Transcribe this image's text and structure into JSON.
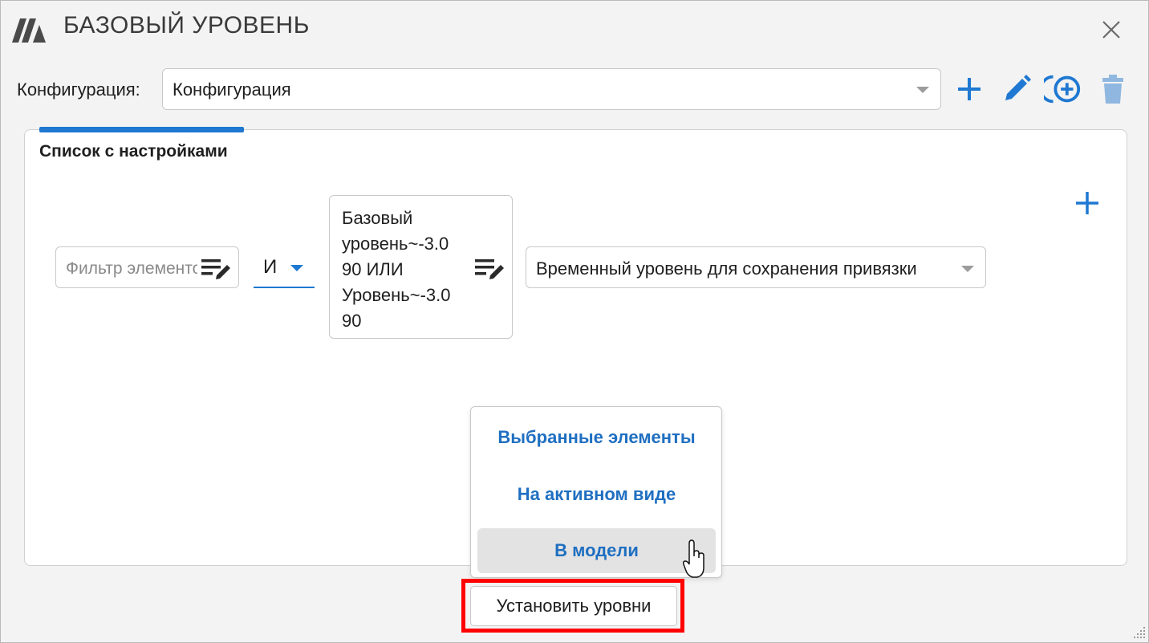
{
  "window": {
    "title": "БАЗОВЫЙ УРОВЕНЬ",
    "logo_icon": "app-logo-icon",
    "close_icon": "close-icon"
  },
  "config": {
    "label": "Конфигурация:",
    "selected": "Конфигурация",
    "toolbar_icons": [
      "plus-icon",
      "pencil-icon",
      "copy-add-icon",
      "trash-icon"
    ]
  },
  "panel": {
    "title": "Список с настройками",
    "filter_placeholder": "Фильтр элементов",
    "logic_operator": "И",
    "expression": "Базовый\nуровень~-3.0\n90 ИЛИ\nУровень~-3.0\n90",
    "target_level": "Временный уровень для сохранения привязки"
  },
  "scope_menu": {
    "items": [
      "Выбранные элементы",
      "На активном виде",
      "В модели"
    ],
    "hovered_index": 2
  },
  "actions": {
    "apply_label": "Установить уровни"
  },
  "colors": {
    "accent": "#1f78d1",
    "menu_text": "#1f6fc1",
    "highlight": "#ff0000",
    "trash_disabled": "#8fb7e0"
  }
}
